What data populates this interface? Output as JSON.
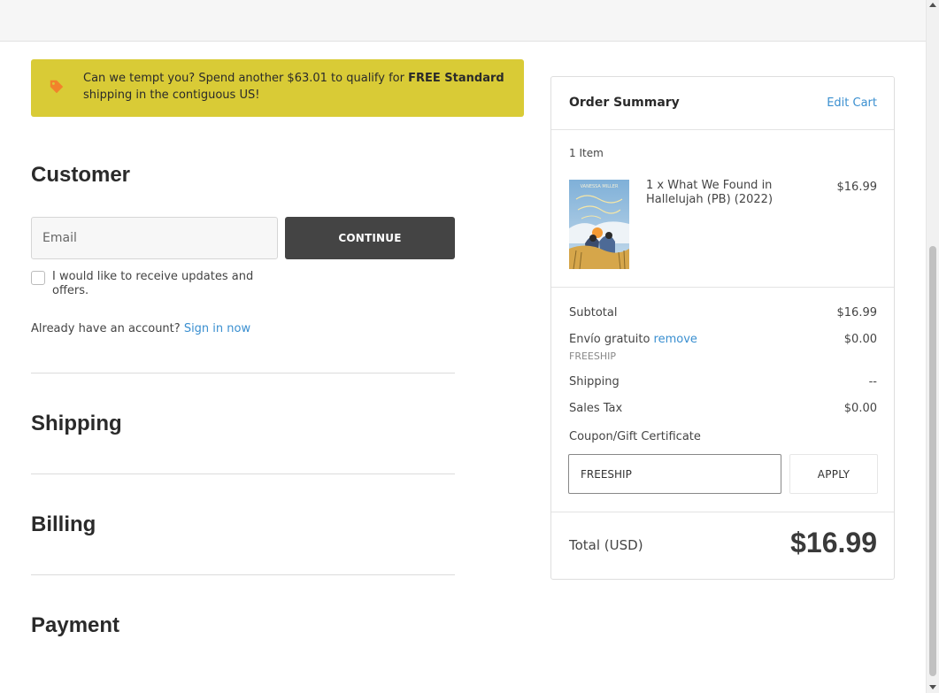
{
  "banner": {
    "text_before": "Can we tempt you? Spend another $63.01 to qualify for ",
    "text_bold": "FREE Standard",
    "text_after": " shipping in the contiguous US!",
    "icon": "tag-icon",
    "background_color": "#d9cb36",
    "icon_color": "#f2822b"
  },
  "customer": {
    "title": "Customer",
    "email_placeholder": "Email",
    "continue_label": "CONTINUE",
    "updates_label": "I would like to receive updates and offers.",
    "account_prompt": "Already have an account?",
    "sign_in_label": "Sign in now"
  },
  "sections": {
    "shipping": "Shipping",
    "billing": "Billing",
    "payment": "Payment"
  },
  "summary": {
    "title": "Order Summary",
    "edit_cart": "Edit Cart",
    "item_count": "1 Item",
    "item": {
      "name": "1 x What We Found in Hallelujah (PB) (2022)",
      "price": "$16.99",
      "cover_author": "VANESSA MILLER",
      "cover_title": "What We Found in Hallelujah"
    },
    "subtotal_label": "Subtotal",
    "subtotal_value": "$16.99",
    "discount_label": "Envío gratuito",
    "discount_remove": "remove",
    "discount_value": "$0.00",
    "discount_code": "FREESHIP",
    "shipping_label": "Shipping",
    "shipping_value": "--",
    "tax_label": "Sales Tax",
    "tax_value": "$0.00",
    "coupon_label": "Coupon/Gift Certificate",
    "coupon_value": "FREESHIP",
    "apply_label": "APPLY",
    "total_label": "Total (USD)",
    "total_value": "$16.99"
  },
  "colors": {
    "accent_link": "#3a8fd0",
    "button_dark": "#444444"
  }
}
